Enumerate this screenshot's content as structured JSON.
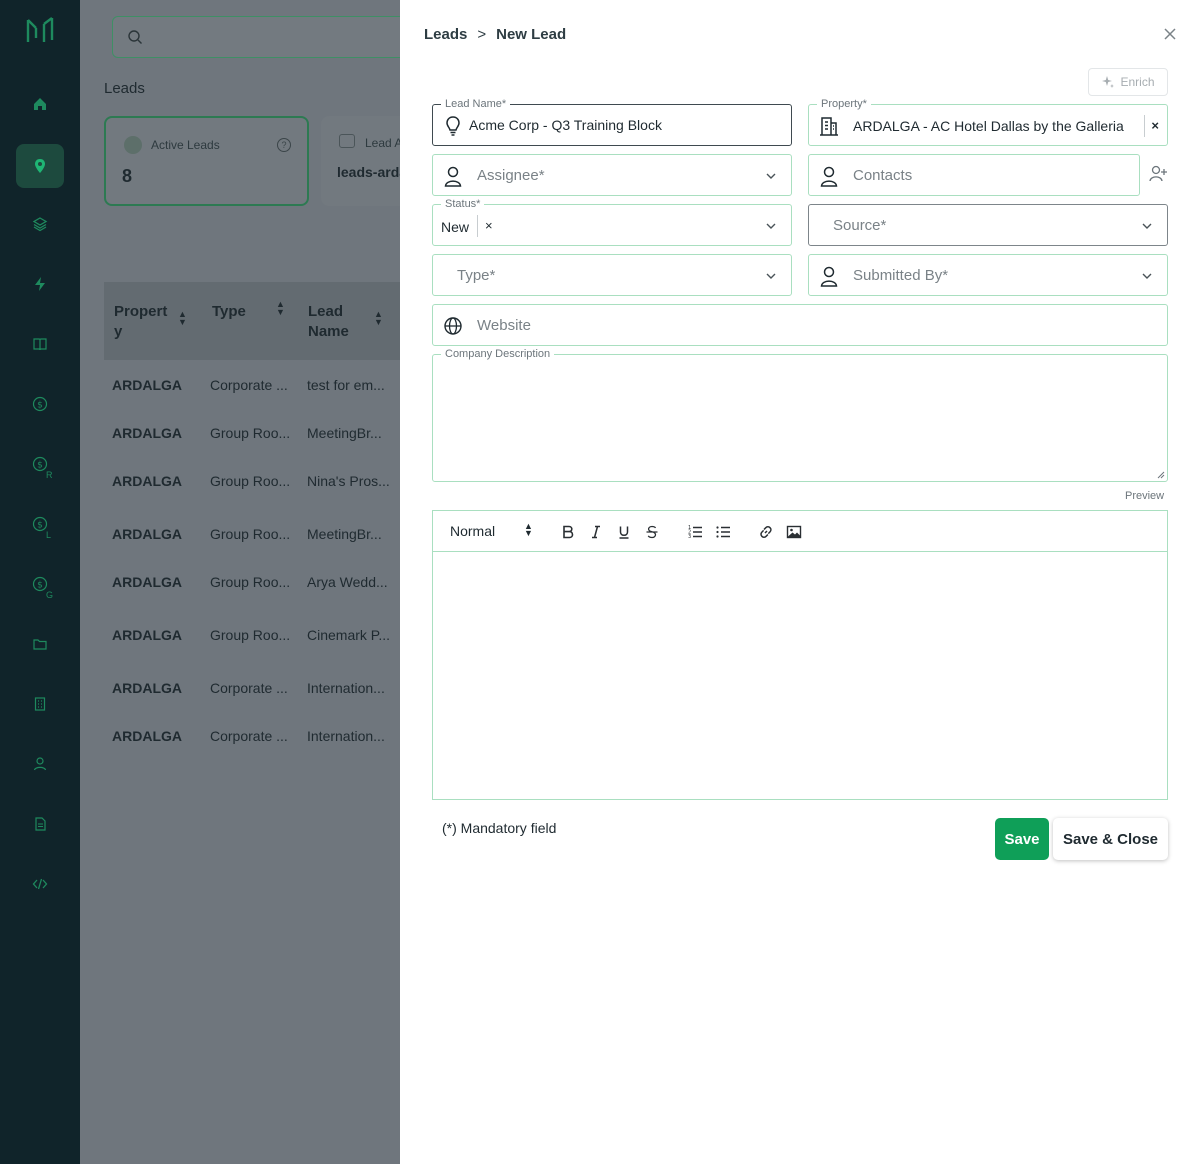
{
  "colors": {
    "accent": "#0f9f58",
    "rail": "#10242a",
    "field_border": "#a9dfc0"
  },
  "rail": {
    "items": [
      {
        "icon": "home-icon"
      },
      {
        "icon": "location-pin-icon",
        "active": true
      },
      {
        "icon": "layers-icon"
      },
      {
        "icon": "bolt-icon"
      },
      {
        "icon": "book-icon"
      },
      {
        "icon": "dollar-icon"
      },
      {
        "icon": "dollar-icon",
        "sub": "R"
      },
      {
        "icon": "dollar-icon",
        "sub": "L"
      },
      {
        "icon": "dollar-icon",
        "sub": "G"
      },
      {
        "icon": "folder-icon"
      },
      {
        "icon": "building-icon"
      },
      {
        "icon": "user-icon"
      },
      {
        "icon": "document-icon"
      },
      {
        "icon": "code-icon"
      }
    ]
  },
  "background": {
    "title": "Leads",
    "card_active": {
      "label": "Active Leads",
      "value": "8"
    },
    "card_second": {
      "label": "Lead A",
      "value": "leads-arda"
    },
    "table": {
      "headers": [
        "Propert y",
        "Type",
        "Lead Name"
      ],
      "rows": [
        [
          "ARDALGA",
          "Corporate ...",
          "test for em..."
        ],
        [
          "ARDALGA",
          "Group Roo...",
          "MeetingBr..."
        ],
        [
          "ARDALGA",
          "Group Roo...",
          "Nina's Pros..."
        ],
        [
          "ARDALGA",
          "Group Roo...",
          "MeetingBr..."
        ],
        [
          "ARDALGA",
          "Group Roo...",
          "Arya Wedd..."
        ],
        [
          "ARDALGA",
          "Group Roo...",
          "Cinemark P..."
        ],
        [
          "ARDALGA",
          "Corporate ...",
          "Internation..."
        ],
        [
          "ARDALGA",
          "Corporate ...",
          "Internation..."
        ]
      ]
    }
  },
  "panel": {
    "breadcrumb": {
      "parent": "Leads",
      "separator": ">",
      "current": "New Lead"
    },
    "enrich_label": "Enrich",
    "fields": {
      "lead_name": {
        "label": "Lead Name*",
        "value": "Acme Corp - Q3 Training Block"
      },
      "property": {
        "label": "Property*",
        "value": "ARDALGA - AC Hotel Dallas by the Galleria",
        "clear": "×"
      },
      "assignee": {
        "placeholder": "Assignee*"
      },
      "contacts": {
        "placeholder": "Contacts"
      },
      "status": {
        "label": "Status*",
        "chip": "New",
        "chip_remove": "×"
      },
      "source": {
        "placeholder": "Source*"
      },
      "type": {
        "placeholder": "Type*"
      },
      "submitted_by": {
        "placeholder": "Submitted By*"
      },
      "website": {
        "placeholder": "Website"
      },
      "company_description": {
        "label": "Company Description",
        "value": ""
      }
    },
    "preview_label": "Preview",
    "editor": {
      "format_select": "Normal",
      "tools": [
        "bold",
        "italic",
        "underline",
        "strikethrough",
        "ordered-list",
        "bullet-list",
        "link",
        "image"
      ]
    },
    "mandatory_note": "(*) Mandatory field",
    "save_label": "Save",
    "save_close_label": "Save & Close"
  }
}
